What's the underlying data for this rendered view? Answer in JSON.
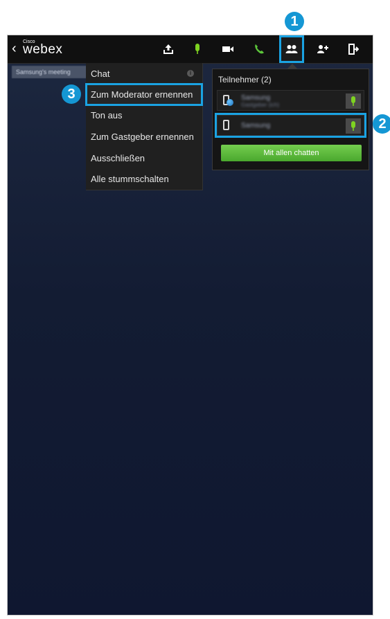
{
  "header": {
    "back_symbol": "‹",
    "logo_small": "Cisco",
    "logo_main": "webex",
    "icons": [
      "upload-icon",
      "microphone-icon",
      "video-icon",
      "phone-icon",
      "participants-icon",
      "add-participant-icon",
      "exit-icon"
    ]
  },
  "meeting_tab": {
    "label": "Samsung's meeting"
  },
  "context_menu": {
    "items": [
      {
        "label": "Chat"
      },
      {
        "label": "Zum Moderator ernennen"
      },
      {
        "label": "Ton aus"
      },
      {
        "label": "Zum Gastgeber ernennen"
      },
      {
        "label": "Ausschließen"
      },
      {
        "label": "Alle stummschalten"
      }
    ]
  },
  "participants": {
    "title": "Teilnehmer (2)",
    "rows": [
      {
        "name": "Samsung",
        "subtitle": "Gastgeber (ich)"
      },
      {
        "name": "Samsung"
      }
    ],
    "chat_all_label": "Mit allen chatten"
  },
  "callouts": [
    "1",
    "2",
    "3"
  ],
  "colors": {
    "highlight": "#1aa3e3",
    "badge": "#1597d4",
    "mic_green": "#7ed321",
    "chat_button": "#5cba3a",
    "background": "#131c33"
  }
}
